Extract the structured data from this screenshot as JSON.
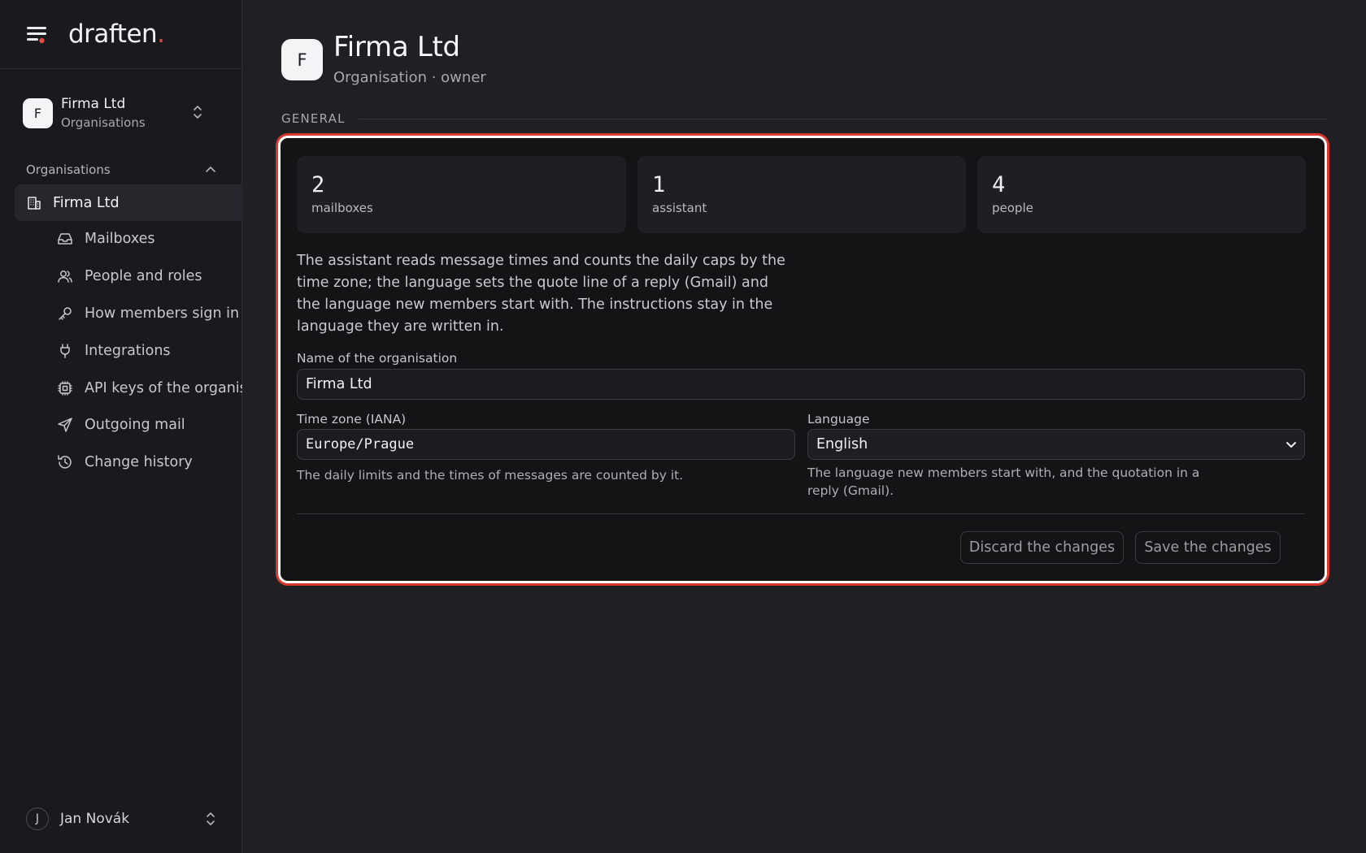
{
  "brand": {
    "name": "draften",
    "dot": "."
  },
  "sidebar": {
    "org_switch": {
      "initial": "F",
      "name": "Firma Ltd",
      "sub": "Organisations"
    },
    "section_label": "Organisations",
    "active_item": {
      "label": "Firma Ltd",
      "icon": "building-icon"
    },
    "items": [
      {
        "label": "Mailboxes",
        "icon": "inbox-icon"
      },
      {
        "label": "People and roles",
        "icon": "users-icon"
      },
      {
        "label": "How members sign in",
        "icon": "key-icon"
      },
      {
        "label": "Integrations",
        "icon": "plug-icon"
      },
      {
        "label": "API keys of the organisation",
        "icon": "cpu-icon"
      },
      {
        "label": "Outgoing mail",
        "icon": "send-icon"
      },
      {
        "label": "Change history",
        "icon": "history-icon"
      }
    ],
    "user": {
      "initial": "J",
      "name": "Jan Novák"
    }
  },
  "page": {
    "initial": "F",
    "title": "Firma Ltd",
    "subtitle": "Organisation · owner",
    "group_label": "GENERAL"
  },
  "stats": [
    {
      "value": "2",
      "label": "mailboxes"
    },
    {
      "value": "1",
      "label": "assistant"
    },
    {
      "value": "4",
      "label": "people"
    }
  ],
  "form": {
    "intro": "The assistant reads message times and counts the daily caps by the time zone; the language sets the quote line of a reply (Gmail) and the language new members start with. The instructions stay in the language they are written in.",
    "name_label": "Name of the organisation",
    "name_value": "Firma Ltd",
    "timezone_label": "Time zone (IANA)",
    "timezone_value": "Europe/Prague",
    "timezone_hint": "The daily limits and the times of messages are counted by it.",
    "language_label": "Language",
    "language_value": "English",
    "language_hint": "The language new members start with, and the quotation in a reply (Gmail).",
    "discard_label": "Discard the changes",
    "save_label": "Save the changes"
  },
  "colors": {
    "accent": "#e5483d",
    "highlight_outline": "#d8392e",
    "background": "#1f1f24",
    "sidebar": "#1a1a1e"
  }
}
